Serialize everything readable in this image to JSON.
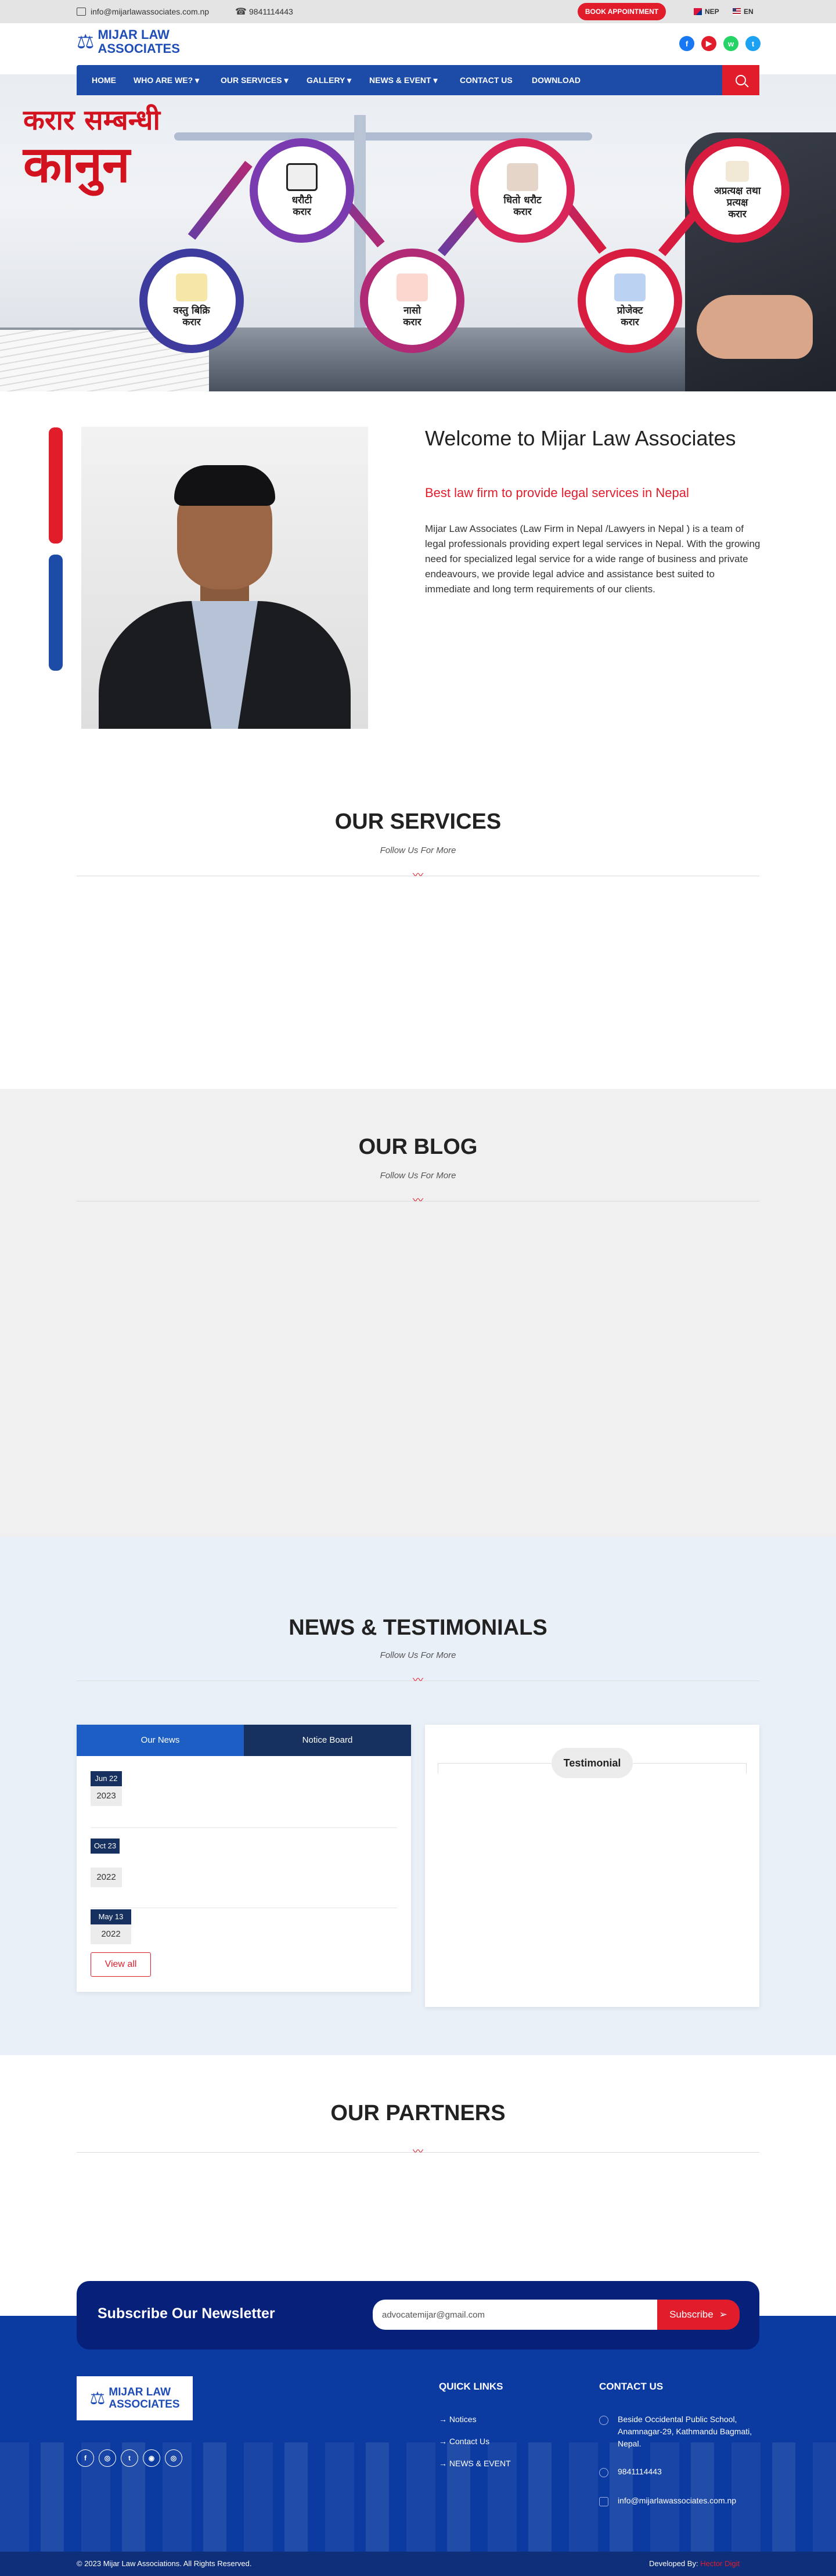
{
  "topbar": {
    "email": "info@mijarlawassociates.com.np",
    "phone": "9841114443",
    "book_label": "BOOK APPOINTMENT",
    "lang_nep": "NEP",
    "lang_en": "EN"
  },
  "logo": {
    "line1": "MIJAR LAW",
    "line2": "ASSOCIATES"
  },
  "header_social": [
    "f",
    "▶",
    "w",
    "t"
  ],
  "nav": {
    "items": [
      "HOME",
      "WHO ARE WE?",
      "OUR SERVICES",
      "GALLERY",
      "NEWS & EVENT",
      "CONTACT US",
      "DOWNLOAD"
    ]
  },
  "hero": {
    "title_line1": "करार सम्बन्धी",
    "title_line2": "कानुन",
    "bubbles": [
      {
        "label": "धरौटी\nकरार"
      },
      {
        "label": "वस्तु बिक्रि\nकरार"
      },
      {
        "label": "नासो\nकरार"
      },
      {
        "label": "धितो धरौट\nकरार"
      },
      {
        "label": "प्रोजेक्ट\nकरार"
      },
      {
        "label": "अप्रत्यक्ष तथा\nप्रत्यक्ष\nकरार"
      }
    ]
  },
  "welcome": {
    "title": "Welcome to Mijar Law Associates",
    "subtitle": "Best law firm to provide legal services in Nepal",
    "body": "Mijar Law Associates (Law Firm in Nepal /Lawyers in Nepal ) is a team of legal professionals providing expert legal services in Nepal. With the growing need for specialized legal service for a wide range of business and private endeavours, we provide legal advice and assistance best suited to immediate and long term requirements of our clients."
  },
  "services": {
    "title": "OUR SERVICES",
    "subtitle": "Follow Us For More"
  },
  "blog": {
    "title": "OUR BLOG",
    "subtitle": "Follow Us For More"
  },
  "news": {
    "title": "NEWS & TESTIMONIALS",
    "subtitle": "Follow Us For More",
    "tab_news": "Our News",
    "tab_notice": "Notice Board",
    "items": [
      {
        "month": "Jun 22",
        "year": "2023"
      },
      {
        "month": "Oct 23",
        "year": "2022"
      },
      {
        "month": "May 13",
        "year": "2022"
      }
    ],
    "view_all": "View all",
    "testimonial_label": "Testimonial"
  },
  "partners": {
    "title": "OUR PARTNERS"
  },
  "newsletter": {
    "title": "Subscribe Our Newsletter",
    "email_value": "advocatemijar@gmail.com",
    "button": "Subscribe"
  },
  "footer": {
    "quick_links_title": "QUICK LINKS",
    "quick_links": [
      "Notices",
      "Contact Us",
      "NEWS & EVENT"
    ],
    "contact_title": "CONTACT US",
    "address": "Beside Occidental Public School, Anamnagar-29, Kathmandu Bagmati, Nepal.",
    "phone": "9841114443",
    "email": "info@mijarlawassociates.com.np",
    "social": [
      "f",
      "◎",
      "t",
      "◉",
      "◎"
    ],
    "copyright": "© 2023 Mijar Law Associations. All Rights Reserved.",
    "developed_by": "Developed By:",
    "developer": "Hector Digit"
  },
  "colors": {
    "brand_blue": "#1c4ba8",
    "accent_red": "#e11d2c",
    "footer_blue": "#0b3aa0"
  }
}
